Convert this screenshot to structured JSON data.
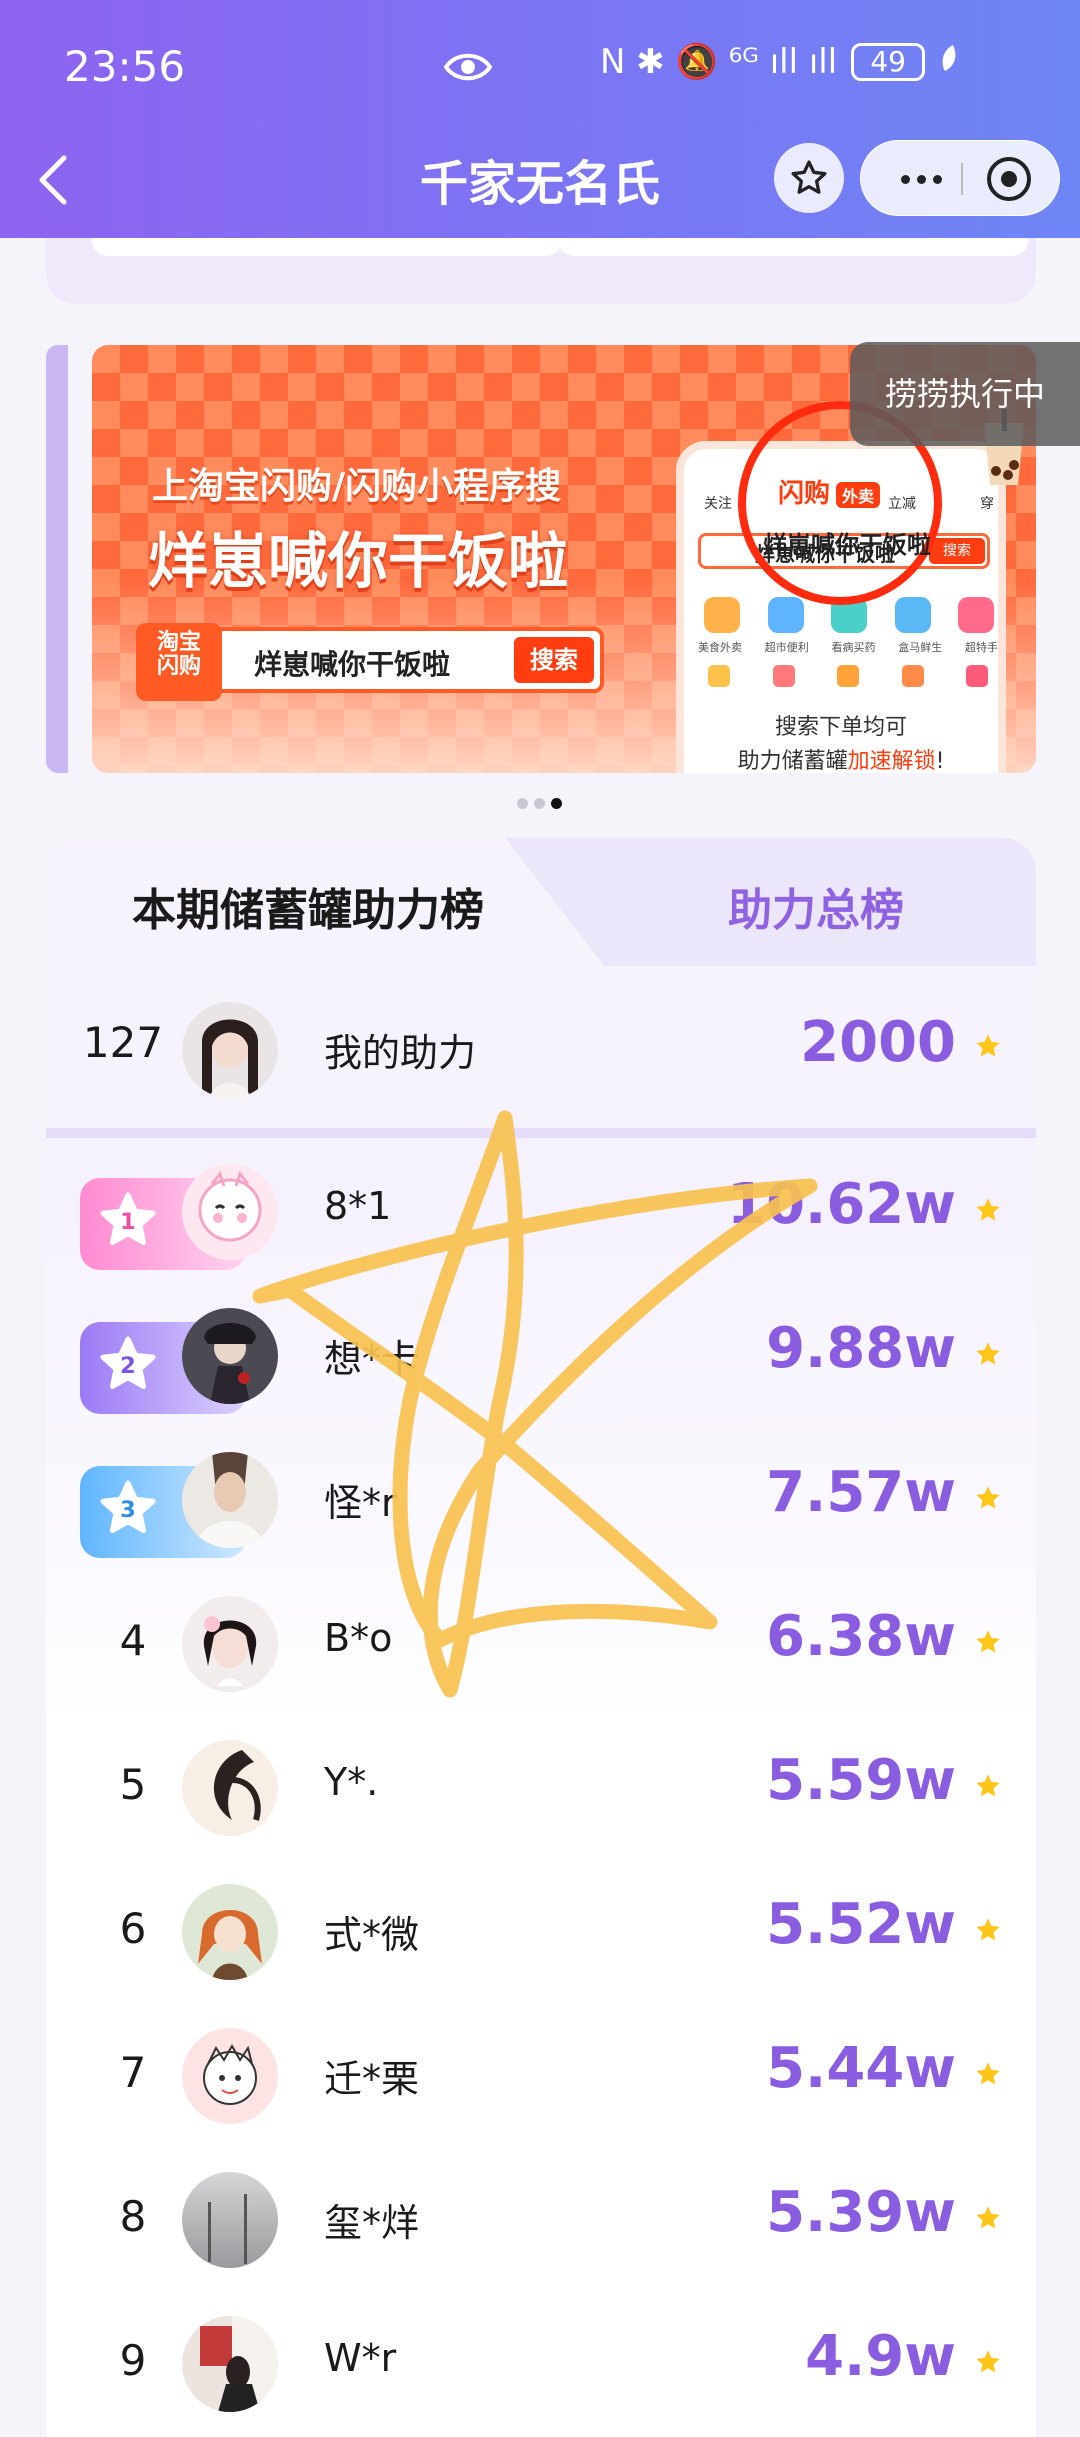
{
  "status_bar": {
    "time": "23:56",
    "signal_icons": "N ✱ 🔕 ⁶ᴳ ıll ıll",
    "battery": "49"
  },
  "nav": {
    "title": "千家无名氏"
  },
  "banner": {
    "line1": "上淘宝闪购/闪购小程序搜",
    "line2": "烊崽喊你干饭啦",
    "search_logo": "淘宝\n闪购",
    "search_text": "烊崽喊你干饭啦",
    "search_button": "搜索",
    "phone_tabs": [
      "关注",
      "闪购",
      "立减",
      "穿"
    ],
    "phone_search_text": "烊崽喊你干饭啦",
    "phone_search_button": "搜索",
    "phone_icon_labels": [
      "美食外卖",
      "超市便利",
      "看病买药",
      "盒马鲜生",
      "超特手"
    ],
    "ring_label": "闪购",
    "ring_tag": "外卖",
    "caption_line1": "搜索下单均可",
    "caption_line2_a": "助力储蓄罐",
    "caption_line2_b": "加速解锁",
    "caption_line2_c": "!"
  },
  "overlay": {
    "label": "捞捞执行中"
  },
  "tabs": {
    "current": "本期储蓄罐助力榜",
    "total": "助力总榜"
  },
  "my_entry": {
    "rank": "127",
    "label": "我的助力",
    "score": "2000"
  },
  "ranking": [
    {
      "rank": "1",
      "name": "8*1",
      "score": "10.62w"
    },
    {
      "rank": "2",
      "name": "想*卡",
      "score": "9.88w"
    },
    {
      "rank": "3",
      "name": "怪*r",
      "score": "7.57w"
    },
    {
      "rank": "4",
      "name": "B*o",
      "score": "6.38w"
    },
    {
      "rank": "5",
      "name": "Y*.",
      "score": "5.59w"
    },
    {
      "rank": "6",
      "name": "式*微",
      "score": "5.52w"
    },
    {
      "rank": "7",
      "name": "迁*栗",
      "score": "5.44w"
    },
    {
      "rank": "8",
      "name": "玺*烊",
      "score": "5.39w"
    },
    {
      "rank": "9",
      "name": "W*r",
      "score": "4.9w"
    }
  ],
  "colors": {
    "accent": "#8a5ce0",
    "header_start": "#8e64f0",
    "header_end": "#6e86f5",
    "star": "#ffc61a",
    "banner_orange": "#ff6a3d",
    "doodle": "#f7c14f"
  }
}
